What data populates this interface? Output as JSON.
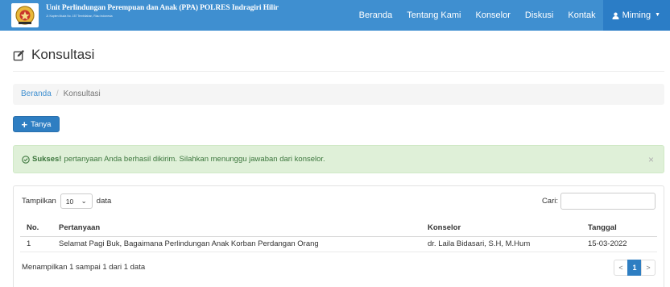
{
  "navbar": {
    "title": "Unit Perlindungan Perempuan dan Anak (PPA) POLRES Indragiri Hilir",
    "subtitle": "Jl. Kapten Muda No. 157 Tembilahan, Riau Indonesia",
    "links": [
      "Beranda",
      "Tentang Kami",
      "Konselor",
      "Diskusi",
      "Kontak"
    ],
    "user": "Miming",
    "colors": {
      "bar": "#3f8fd0",
      "user_bg": "#2b7dc6"
    }
  },
  "page": {
    "title": "Konsultasi"
  },
  "breadcrumb": {
    "home": "Beranda",
    "current": "Konsultasi"
  },
  "ask_button": {
    "label": "Tanya"
  },
  "alert": {
    "strong": "Sukses!",
    "message": "pertanyaan Anda berhasil dikirim. Silahkan menunggu jawaban dari konselor.",
    "close": "×",
    "color": "#dff0d8"
  },
  "table_controls": {
    "show_label": "Tampilkan",
    "show_value": "10",
    "show_suffix": "data",
    "search_label": "Cari:",
    "search_value": ""
  },
  "table": {
    "headers": {
      "no": "No.",
      "question": "Pertanyaan",
      "counselor": "Konselor",
      "date": "Tanggal"
    },
    "rows": [
      {
        "no": "1",
        "question": "Selamat Pagi Buk, Bagaimana Perlindungan Anak Korban Perdangan Orang",
        "counselor": "dr. Laila Bidasari, S.H, M.Hum",
        "date": "15-03-2022"
      }
    ]
  },
  "pagination": {
    "info": "Menampilkan 1 sampai 1 dari 1 data",
    "prev": "<",
    "current": "1",
    "next": ">"
  }
}
